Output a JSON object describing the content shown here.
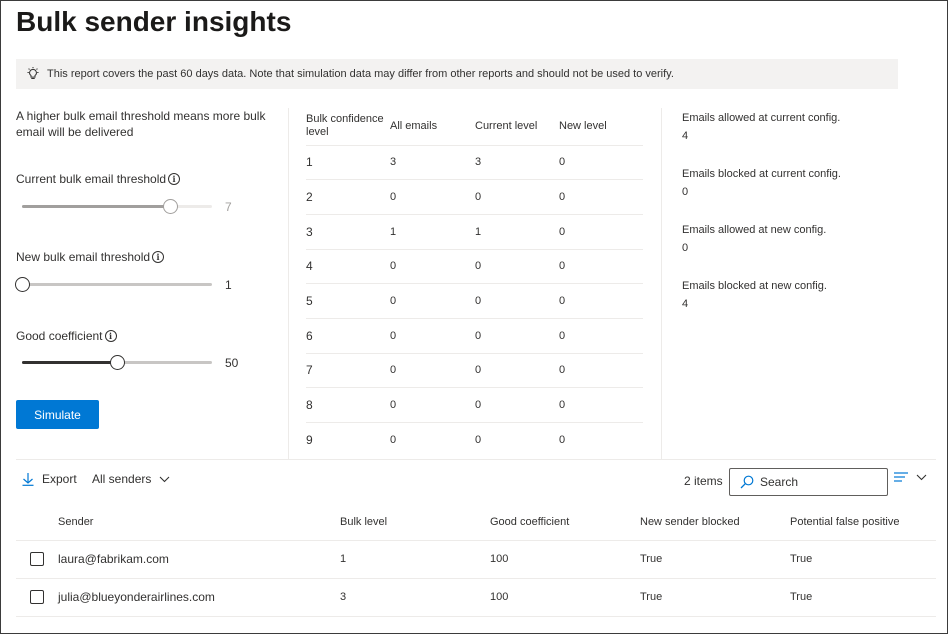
{
  "page": {
    "title": "Bulk sender insights"
  },
  "banner": {
    "icon": "lightbulb-icon",
    "text": "This report covers the past 60 days data. Note that simulation data may differ from other reports and should not be used to verify."
  },
  "left": {
    "description": "A higher bulk email threshold means more bulk email will be delivered",
    "current_threshold": {
      "label": "Current bulk email threshold",
      "value": "7",
      "level": 0.78
    },
    "new_threshold": {
      "label": "New bulk email threshold",
      "value": "1",
      "level": 0.0
    },
    "good_coefficient": {
      "label": "Good coefficient",
      "value": "50",
      "level": 0.5
    },
    "simulate_label": "Simulate"
  },
  "levels_table": {
    "headers": [
      "Bulk confidence level",
      "All emails",
      "Current level",
      "New level"
    ],
    "rows": [
      [
        "1",
        "3",
        "3",
        "0"
      ],
      [
        "2",
        "0",
        "0",
        "0"
      ],
      [
        "3",
        "1",
        "1",
        "0"
      ],
      [
        "4",
        "0",
        "0",
        "0"
      ],
      [
        "5",
        "0",
        "0",
        "0"
      ],
      [
        "6",
        "0",
        "0",
        "0"
      ],
      [
        "7",
        "0",
        "0",
        "0"
      ],
      [
        "8",
        "0",
        "0",
        "0"
      ],
      [
        "9",
        "0",
        "0",
        "0"
      ]
    ]
  },
  "stats": [
    {
      "label": "Emails allowed at current config.",
      "value": "4"
    },
    {
      "label": "Emails blocked at current config.",
      "value": "0"
    },
    {
      "label": "Emails allowed at new config.",
      "value": "0"
    },
    {
      "label": "Emails blocked at new config.",
      "value": "4"
    }
  ],
  "toolbar": {
    "export_label": "Export",
    "filter_label": "All senders",
    "count_label": "2 items",
    "search_placeholder": "Search"
  },
  "senders_table": {
    "headers": [
      "Sender",
      "Bulk level",
      "Good coefficient",
      "New sender blocked",
      "Potential false positive"
    ],
    "rows": [
      [
        "laura@fabrikam.com",
        "1",
        "100",
        "True",
        "True"
      ],
      [
        "julia@blueyonderairlines.com",
        "3",
        "100",
        "True",
        "True"
      ]
    ]
  },
  "colors": {
    "accent": "#0078d4",
    "banner_bg": "#f3f2f1"
  }
}
